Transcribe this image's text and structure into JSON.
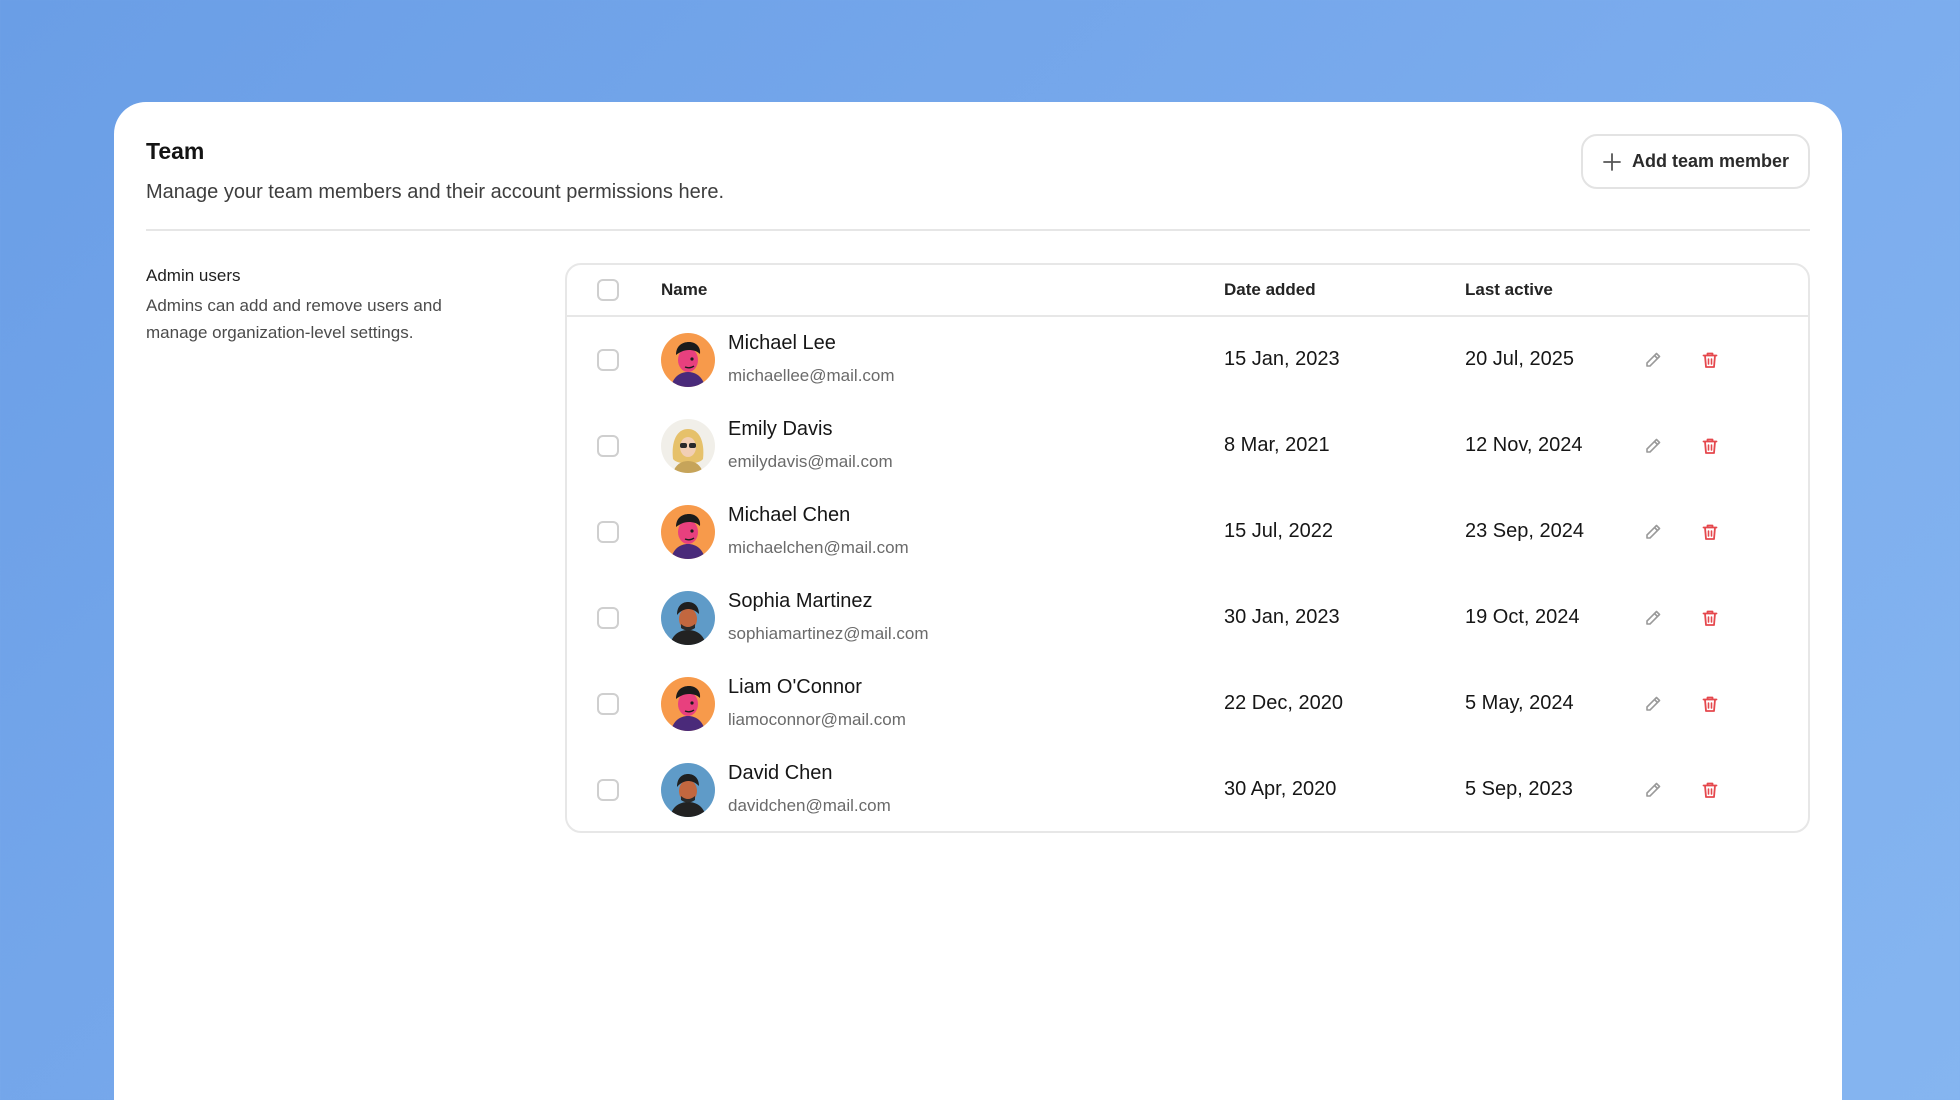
{
  "header": {
    "title": "Team",
    "description": "Manage your team members and their account permissions here.",
    "add_button_label": "Add team member"
  },
  "section": {
    "title": "Admin users",
    "description": "Admins can add and remove users and manage organization-level settings."
  },
  "table": {
    "columns": {
      "name": "Name",
      "date_added": "Date added",
      "last_active": "Last active"
    },
    "rows": [
      {
        "name": "Michael Lee",
        "email": "michaellee@mail.com",
        "date_added": "15 Jan, 2023",
        "last_active": "20 Jul, 2025",
        "avatar": "orange-avatar"
      },
      {
        "name": "Emily Davis",
        "email": "emilydavis@mail.com",
        "date_added": "8 Mar, 2021",
        "last_active": "12 Nov, 2024",
        "avatar": "blonde-avatar"
      },
      {
        "name": "Michael Chen",
        "email": "michaelchen@mail.com",
        "date_added": "15 Jul, 2022",
        "last_active": "23 Sep, 2024",
        "avatar": "orange-avatar"
      },
      {
        "name": "Sophia Martinez",
        "email": "sophiamartinez@mail.com",
        "date_added": "30 Jan, 2023",
        "last_active": "19 Oct, 2024",
        "avatar": "blue-avatar"
      },
      {
        "name": "Liam O'Connor",
        "email": "liamoconnor@mail.com",
        "date_added": "22 Dec, 2020",
        "last_active": "5 May, 2024",
        "avatar": "orange-avatar"
      },
      {
        "name": "David Chen",
        "email": "davidchen@mail.com",
        "date_added": "30 Apr, 2020",
        "last_active": "5 Sep, 2023",
        "avatar": "blue-avatar"
      }
    ]
  },
  "colors": {
    "delete_icon": "#e5484d",
    "edit_icon": "#9a9a9a",
    "background": "#6a9ee6"
  },
  "icons": {
    "add": "plus-icon",
    "edit": "pencil-icon",
    "delete": "trash-icon"
  }
}
